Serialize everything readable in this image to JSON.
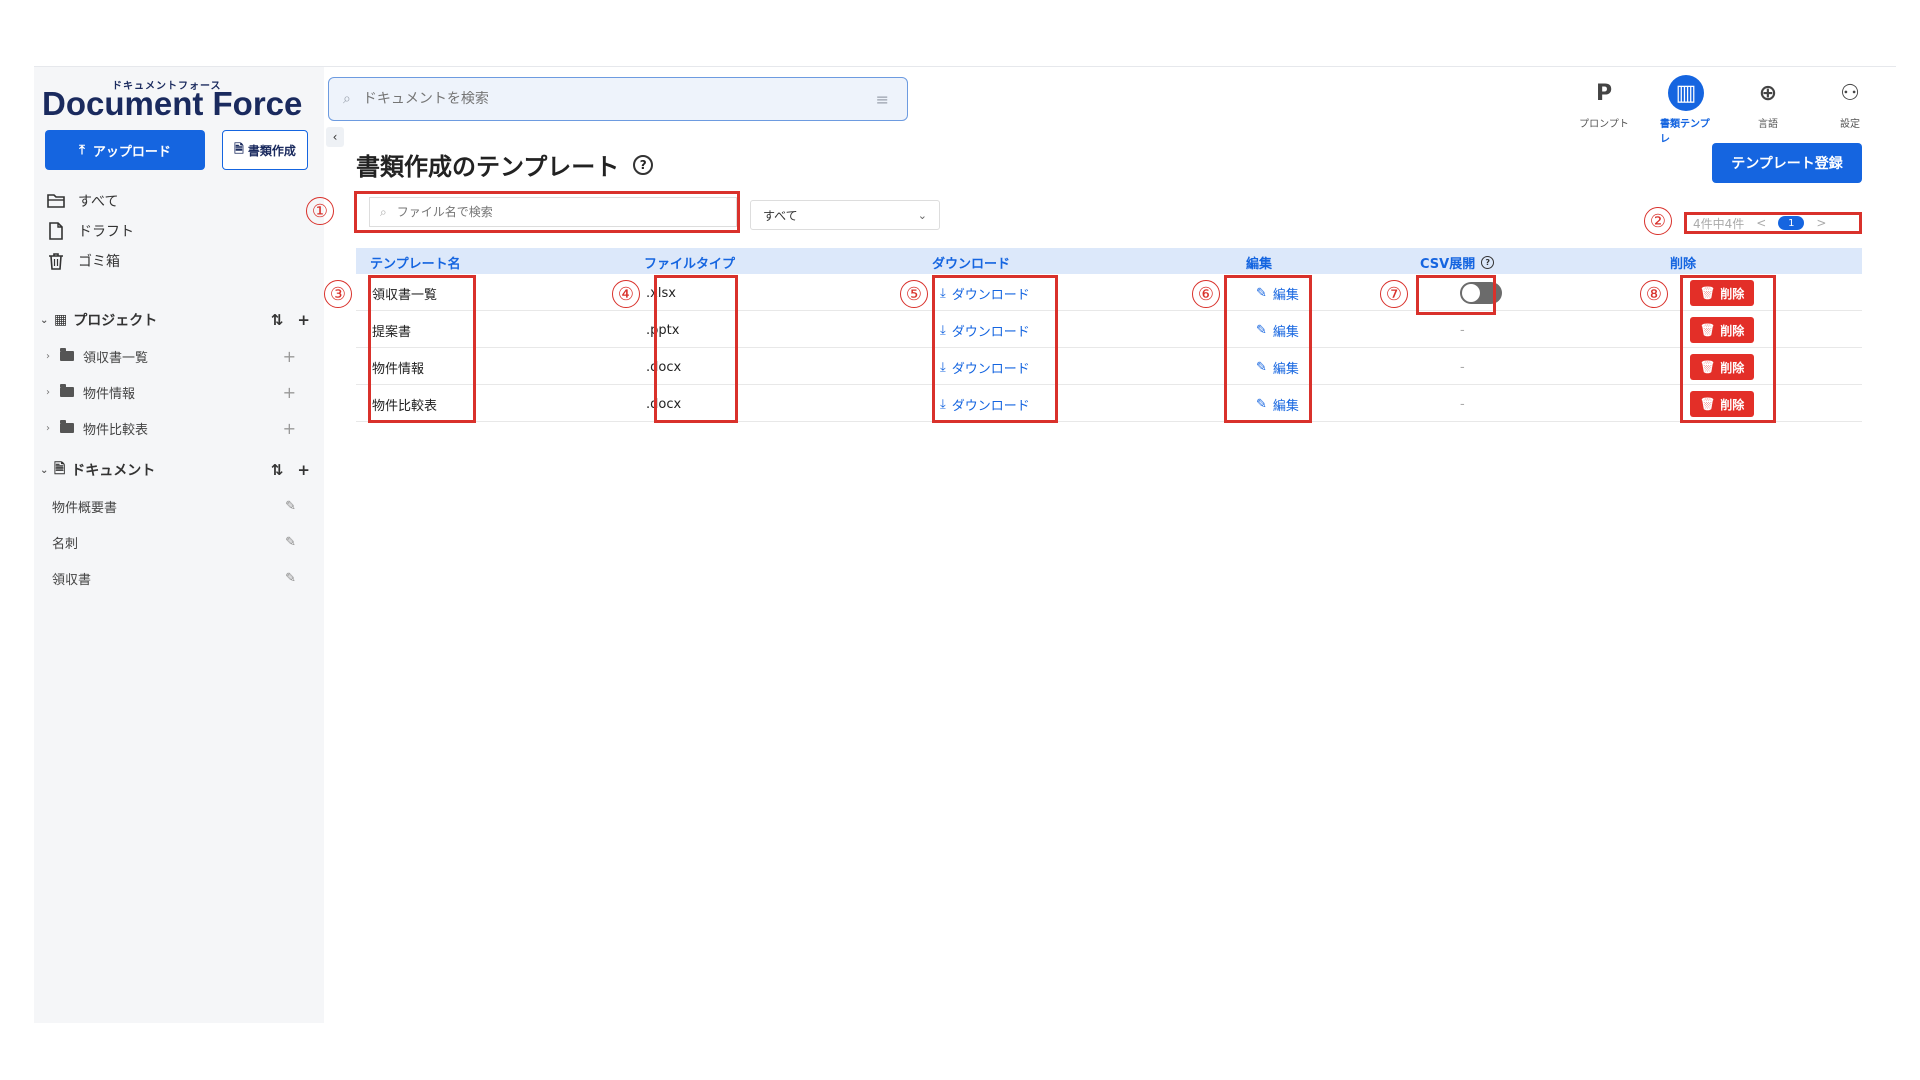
{
  "app": {
    "logo_kana": "ドキュメントフォース",
    "logo_text": "Document Force"
  },
  "sidebar": {
    "upload_label": "アップロード",
    "create_label": "書類作成",
    "nav": [
      {
        "label": "すべて",
        "icon": "folder-open-icon"
      },
      {
        "label": "ドラフト",
        "icon": "file-icon"
      },
      {
        "label": "ゴミ箱",
        "icon": "trash-icon"
      }
    ],
    "projects": {
      "title": "プロジェクト",
      "items": [
        {
          "label": "領収書一覧"
        },
        {
          "label": "物件情報"
        },
        {
          "label": "物件比較表"
        }
      ]
    },
    "documents": {
      "title": "ドキュメント",
      "items": [
        {
          "label": "物件概要書"
        },
        {
          "label": "名刺"
        },
        {
          "label": "領収書"
        }
      ]
    }
  },
  "header": {
    "search_placeholder": "ドキュメントを検索",
    "icons": [
      {
        "label": "プロンプト",
        "glyph": "P",
        "active": false
      },
      {
        "label": "書類テンプレ",
        "glyph": "▥",
        "active": true
      },
      {
        "label": "言語",
        "glyph": "⊕",
        "active": false
      },
      {
        "label": "設定",
        "glyph": "⚇",
        "active": false
      }
    ]
  },
  "main": {
    "title": "書類作成のテンプレート",
    "register_label": "テンプレート登録",
    "file_search_placeholder": "ファイル名で検索",
    "filter_value": "すべて",
    "pager": {
      "summary": "4件中4件",
      "prev": "<",
      "current": "1",
      "next": ">"
    },
    "columns": {
      "name": "テンプレート名",
      "type": "ファイルタイプ",
      "download": "ダウンロード",
      "edit": "編集",
      "csv": "CSV展開",
      "delete": "削除"
    },
    "rows": [
      {
        "name": "領収書一覧",
        "type": ".xlsx",
        "download": "ダウンロード",
        "edit": "編集",
        "csv": "toggle",
        "delete": "削除"
      },
      {
        "name": "提案書",
        "type": ".pptx",
        "download": "ダウンロード",
        "edit": "編集",
        "csv": "-",
        "delete": "削除"
      },
      {
        "name": "物件情報",
        "type": ".docx",
        "download": "ダウンロード",
        "edit": "編集",
        "csv": "-",
        "delete": "削除"
      },
      {
        "name": "物件比較表",
        "type": ".docx",
        "download": "ダウンロード",
        "edit": "編集",
        "csv": "-",
        "delete": "削除"
      }
    ]
  },
  "annotations": {
    "markers": [
      "①",
      "②",
      "③",
      "④",
      "⑤",
      "⑥",
      "⑦",
      "⑧"
    ]
  },
  "colors": {
    "primary": "#1565e0",
    "danger": "#e32f28",
    "annotation": "#d9312b",
    "header_row": "#dce8fa"
  }
}
